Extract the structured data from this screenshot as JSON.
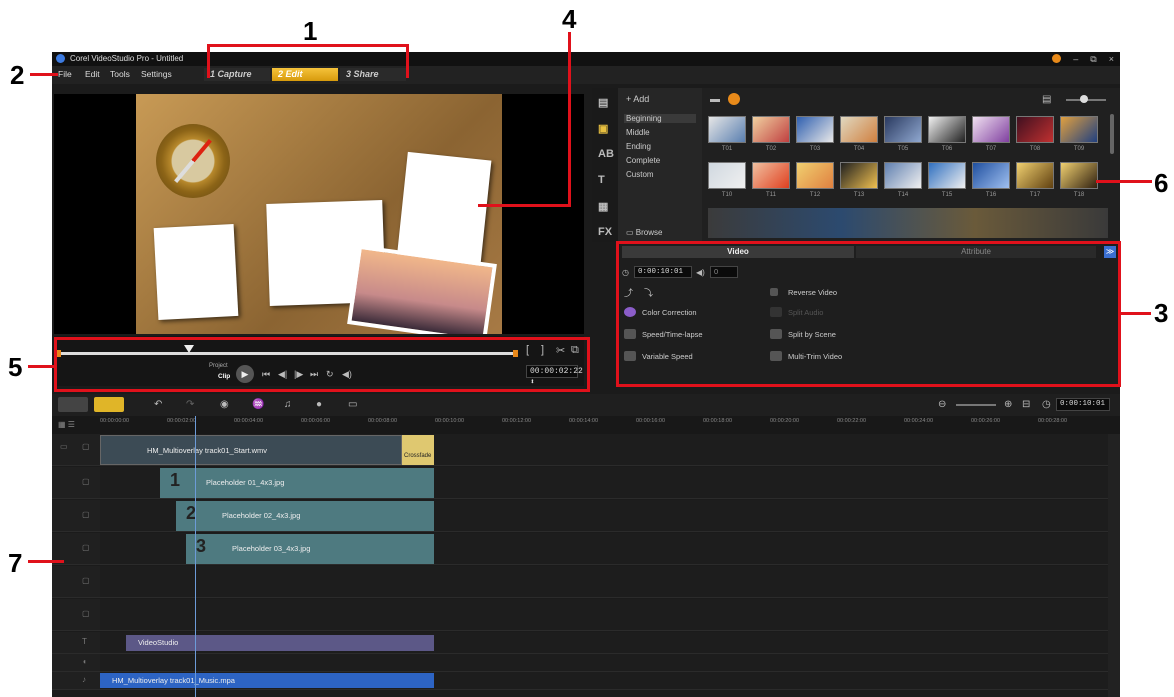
{
  "callouts": [
    "1",
    "2",
    "3",
    "4",
    "5",
    "6",
    "7"
  ],
  "window": {
    "title": "Corel VideoStudio Pro - Untitled",
    "controls": [
      "–",
      "⧉",
      "×"
    ]
  },
  "menu": [
    "File",
    "Edit",
    "Tools",
    "Settings"
  ],
  "steps": [
    {
      "num": "1",
      "label": "Capture"
    },
    {
      "num": "2",
      "label": "Edit"
    },
    {
      "num": "3",
      "label": "Share"
    }
  ],
  "player": {
    "project_label": "Project",
    "clip_label": "Clip",
    "timecode": "00:00:02:22 ⬍"
  },
  "library": {
    "add_label": "Add",
    "categories": [
      "Beginning",
      "Middle",
      "Ending",
      "Complete",
      "Custom"
    ],
    "browse_label": "Browse",
    "thumbs_row1": [
      "T01",
      "T02",
      "T03",
      "T04",
      "T05",
      "T06",
      "T07",
      "T08",
      "T09"
    ],
    "thumbs_row2": [
      "T10",
      "T11",
      "T12",
      "T13",
      "T14",
      "T15",
      "T16",
      "T17",
      "T18"
    ]
  },
  "options": {
    "tabs": [
      "Video",
      "Attribute"
    ],
    "duration": "0:00:10:01",
    "volume": "0",
    "color_correction": "Color Correction",
    "speed_timelapse": "Speed/Time-lapse",
    "variable_speed": "Variable Speed",
    "reverse_video": "Reverse Video",
    "split_audio": "Split Audio",
    "split_by_scene": "Split by Scene",
    "multi_trim": "Multi-Trim Video"
  },
  "timeline": {
    "timecode": "0:00:10:01",
    "ruler": [
      "00:00:00:00",
      "00:00:02:00",
      "00:00:04:00",
      "00:00:06:00",
      "00:00:08:00",
      "00:00:10:00",
      "00:00:12:00",
      "00:00:14:00",
      "00:00:16:00",
      "00:00:18:00",
      "00:00:20:00",
      "00:00:22:00",
      "00:00:24:00",
      "00:00:26:00",
      "00:00:28:00"
    ],
    "video_clip": "HM_Multioverlay track01_Start.wmv",
    "transition": "Crossfade",
    "overlay_clips": [
      "Placeholder 01_4x3.jpg",
      "Placeholder 02_4x3.jpg",
      "Placeholder 03_4x3.jpg"
    ],
    "overlay_nums": [
      "1",
      "2",
      "3"
    ],
    "title_clip": "VideoStudio",
    "music_clip": "HM_Multioverlay track01_Music.mpa"
  }
}
